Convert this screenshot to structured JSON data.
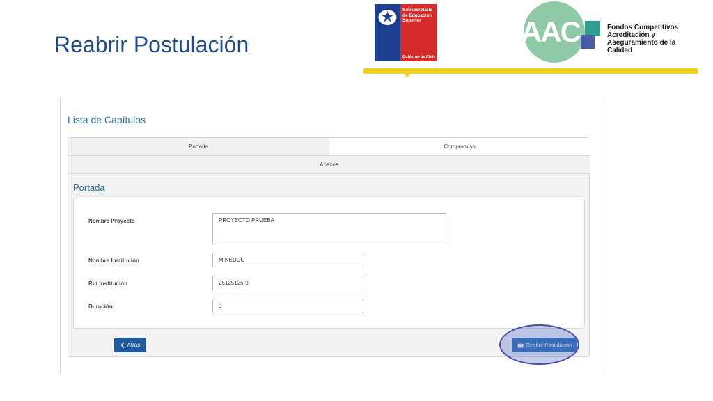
{
  "slide": {
    "title": "Reabrir Postulación"
  },
  "logos": {
    "gob": {
      "line1": "Subsecretaría",
      "line2": "de Educación",
      "line3": "Superior",
      "footer": "Gobierno de Chile"
    },
    "aac": {
      "letters": "AAC",
      "line1": "Fondos Competitivos",
      "line2": "Acreditación y",
      "line3": "Aseguramiento de la Calidad"
    }
  },
  "colors": {
    "accent_bar": "#f2d022",
    "title": "#1f4e8c",
    "button": "#2d6db3",
    "highlight": "#4a4fa8"
  },
  "app": {
    "section_title": "Lista de Capítulos",
    "tabs": [
      {
        "label": "Portada"
      },
      {
        "label": "Compromiso"
      },
      {
        "label": "Anexos"
      }
    ],
    "panel_heading": "Portada",
    "form": {
      "nombre_proyecto": {
        "label": "Nombre Proyecto",
        "value": "PROYECTO PRUEBA"
      },
      "nombre_institucion": {
        "label": "Nombre Institución",
        "value": "MINEDUC"
      },
      "rut_institucion": {
        "label": "Rut Institución",
        "value": "25125125-9"
      },
      "duracion": {
        "label": "Duración",
        "value": "0"
      }
    },
    "buttons": {
      "atras": {
        "label": "Atrás",
        "icon": "chevron-left-icon"
      },
      "reabrir": {
        "label": "Reabrir Postulación",
        "icon": "briefcase-icon"
      }
    }
  }
}
